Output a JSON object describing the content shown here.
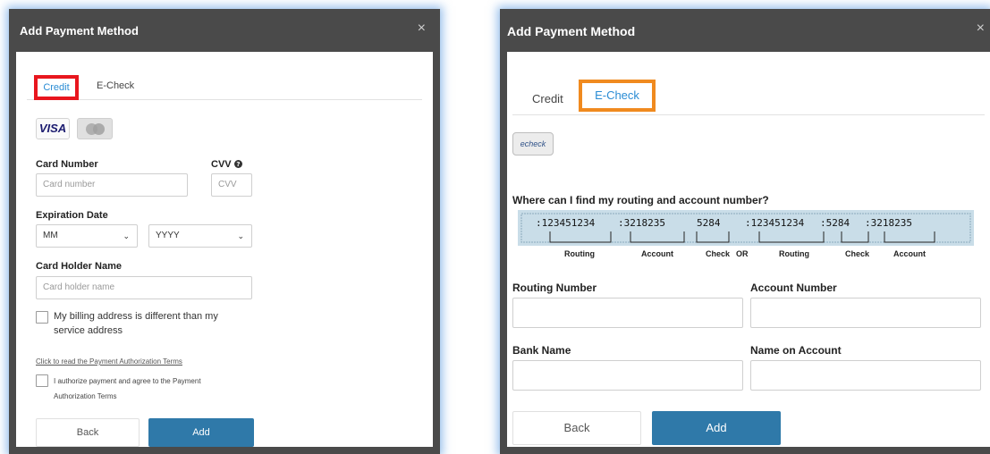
{
  "left": {
    "title": "Add Payment Method",
    "close": "×",
    "tabs": [
      {
        "label": "Credit",
        "active": true
      },
      {
        "label": "E-Check",
        "active": false
      }
    ],
    "cards": [
      "VISA",
      "MasterCard"
    ],
    "card_number": {
      "label": "Card Number",
      "placeholder": "Card number"
    },
    "cvv": {
      "label": "CVV",
      "help_icon": "question-circle-icon",
      "placeholder": "CVV"
    },
    "expiration": {
      "label": "Expiration Date",
      "month": "MM",
      "year": "YYYY"
    },
    "holder": {
      "label": "Card Holder Name",
      "placeholder": "Card holder name"
    },
    "billing_checkbox": "My billing address is different than my service address",
    "terms_link": "Click to read the Payment Authorization Terms",
    "authorize_checkbox": "I authorize payment and agree to the Payment Authorization Terms",
    "back_label": "Back",
    "add_label": "Add",
    "highlight_color": "#e8161e"
  },
  "right": {
    "title": "Add Payment Method",
    "close": "×",
    "tabs": [
      {
        "label": "Credit",
        "active": false
      },
      {
        "label": "E-Check",
        "active": true
      }
    ],
    "echeck_logo": "echeck",
    "question": "Where can I find my routing and account number?",
    "micr_line": [
      ":123451234",
      ":3218235",
      "5284",
      ":123451234",
      ":5284",
      ":3218235"
    ],
    "diagram_labels": [
      "Routing",
      "Account",
      "Check",
      "OR",
      "Routing",
      "Check",
      "Account"
    ],
    "routing": {
      "label": "Routing Number"
    },
    "account": {
      "label": "Account Number"
    },
    "bank": {
      "label": "Bank Name"
    },
    "name_on_account": {
      "label": "Name on Account"
    },
    "back_label": "Back",
    "add_label": "Add",
    "highlight_color": "#f08a1f"
  },
  "colors": {
    "header_bg": "#4a4a4a",
    "primary": "#2f79a9",
    "link_blue": "#2a8cd4"
  }
}
